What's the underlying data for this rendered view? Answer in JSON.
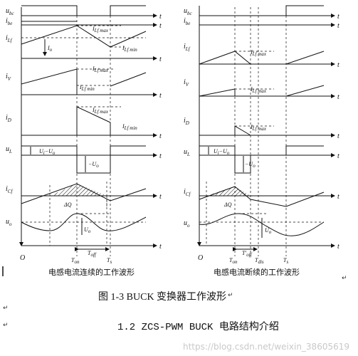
{
  "left_panel": {
    "labels": {
      "ubc": "u",
      "ubc_sub": "bc",
      "ibe": "i",
      "ibe_sub": "be",
      "iLf": "i",
      "iLf_sub": "Lf",
      "iV": "i",
      "iV_sub": "V",
      "iD": "i",
      "iD_sub": "D",
      "uL": "u",
      "uL_sub": "L",
      "iCf": "i",
      "iCf_sub": "Cf",
      "uo": "u",
      "uo_sub": "o",
      "origin": "O",
      "t": "t"
    },
    "annotations": {
      "iLfmax": "I",
      "iLfmax_sub": "Lf max",
      "iLfmin": "I",
      "iLfmin_sub": "Lf min",
      "io": "I",
      "io_sub": "o",
      "ui_uo": "U",
      "ui_uo_rest": "−U",
      "ui_uo_sub1": "i",
      "ui_uo_sub2": "o",
      "minus_uo": "−U",
      "minus_uo_sub": "o",
      "dq": "ΔQ",
      "uo_ripple": "U",
      "uo_ripple_sub": "o",
      "ton": "T",
      "ton_sub": "on",
      "toff": "T",
      "toff_sub": "off",
      "ts": "T",
      "ts_sub": "s"
    },
    "caption": "电感电流连续的工作波形"
  },
  "right_panel": {
    "annotations": {
      "iLfmax": "I",
      "iLfmax_sub": "Lf max",
      "iLfmax2": "I",
      "iLfmax2_sub": "Lf max",
      "ton": "T",
      "ton_sub": "on",
      "toff": "T′",
      "toff_sub": "off",
      "tdis": "T",
      "tdis_sub": "dis",
      "ts": "T",
      "ts_sub": "s"
    },
    "caption": "电感电流断续的工作波形"
  },
  "figure_caption": "图 1-3 BUCK 变换器工作波形",
  "section_heading": "1.2  ZCS-PWM BUCK 电路结构介绍",
  "return_mark": "↵",
  "watermark": "https://blog.csdn.net/weixin_38605619"
}
